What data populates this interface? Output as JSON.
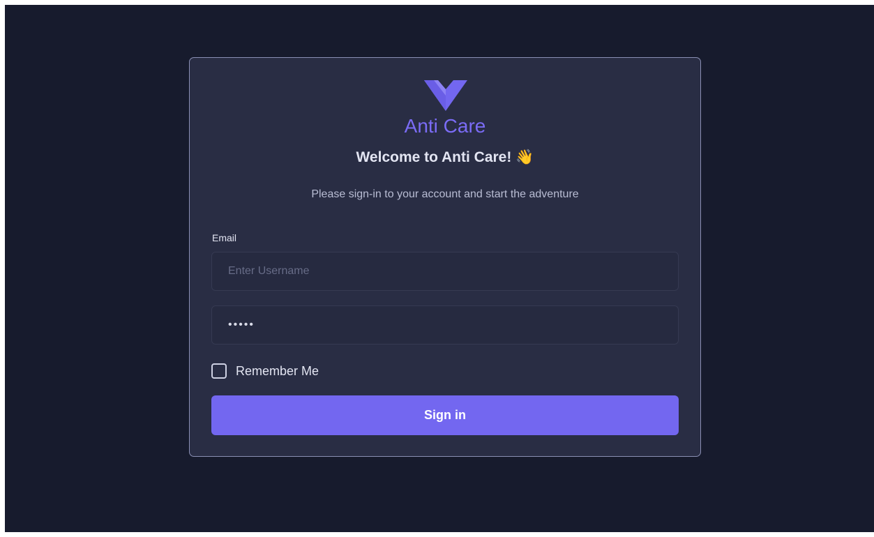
{
  "brand": {
    "logo_icon": "heart-chevron-logo-icon",
    "name": "Anti Care",
    "color": "#7b6cf6"
  },
  "header": {
    "welcome": "Welcome to Anti Care!",
    "wave_emoji": "👋",
    "subtitle": "Please sign-in to your account and start the adventure"
  },
  "form": {
    "email_label": "Email",
    "email_value": "",
    "email_placeholder": "Enter Username",
    "password_value": "•••••",
    "remember_label": "Remember Me",
    "remember_checked": false,
    "submit_label": "Sign in"
  },
  "colors": {
    "page_background": "#171b2d",
    "card_background": "#292d44",
    "accent": "#7367f0"
  }
}
